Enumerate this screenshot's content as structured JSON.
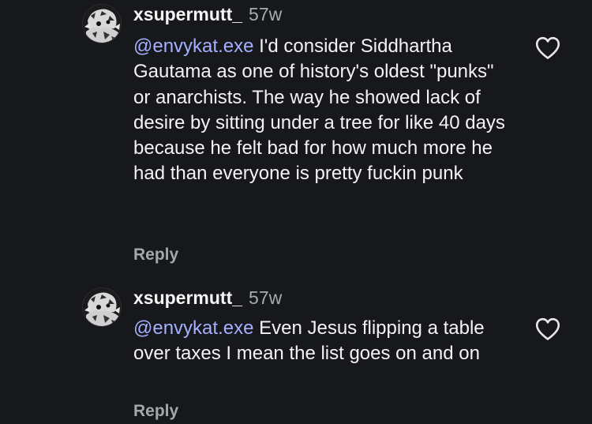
{
  "comments": [
    {
      "username": "xsupermutt_",
      "time": "57w",
      "mention": "@envykat.exe",
      "text": " I'd consider Siddhartha Gautama as one of history's oldest \"punks\" or anarchists. The way he showed lack of desire by sitting under a tree for like 40 days because he felt bad for how much more he had than everyone is pretty fuckin punk",
      "reply_label": "Reply",
      "avatar_icon": "profile-avatar",
      "like_icon": "heart-outline-icon"
    },
    {
      "username": "xsupermutt_",
      "time": "57w",
      "mention": "@envykat.exe",
      "text": " Even Jesus flipping a table over taxes I mean the list goes on and on",
      "reply_label": "Reply",
      "avatar_icon": "profile-avatar",
      "like_icon": "heart-outline-icon"
    }
  ],
  "colors": {
    "background": "#16181b",
    "text": "#f3f3f4",
    "mention": "#a4b0ff",
    "secondary": "#a8abb1",
    "reply": "#a4a7ad"
  }
}
